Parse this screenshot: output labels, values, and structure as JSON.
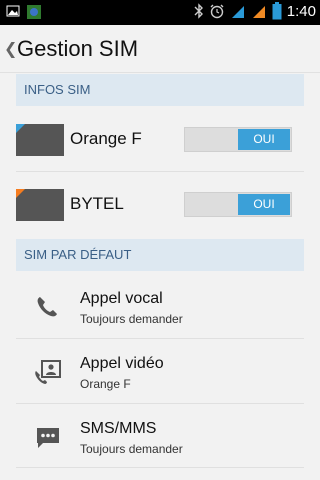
{
  "status_bar": {
    "time": "1:40",
    "icons": [
      "image-icon",
      "app-icon",
      "bluetooth-icon",
      "alarm-icon",
      "signal-icon",
      "signal-icon",
      "battery-icon"
    ]
  },
  "header": {
    "title": "Gestion SIM"
  },
  "sections": {
    "infos_sim": "INFOS SIM",
    "sim_par_defaut": "SIM PAR DÉFAUT"
  },
  "sims": [
    {
      "name": "Orange F",
      "toggle_label": "OUI",
      "corner_color": "#3ba0d8"
    },
    {
      "name": "BYTEL",
      "toggle_label": "OUI",
      "corner_color": "#f57c1f"
    }
  ],
  "preferences": [
    {
      "title": "Appel vocal",
      "subtitle": "Toujours demander",
      "icon": "phone-icon"
    },
    {
      "title": "Appel vidéo",
      "subtitle": "Orange F",
      "icon": "video-call-icon"
    },
    {
      "title": "SMS/MMS",
      "subtitle": "Toujours demander",
      "icon": "message-icon"
    }
  ],
  "colors": {
    "accent": "#3ba0d8",
    "section_bg": "#dde8f1",
    "section_text": "#3a5f86"
  }
}
